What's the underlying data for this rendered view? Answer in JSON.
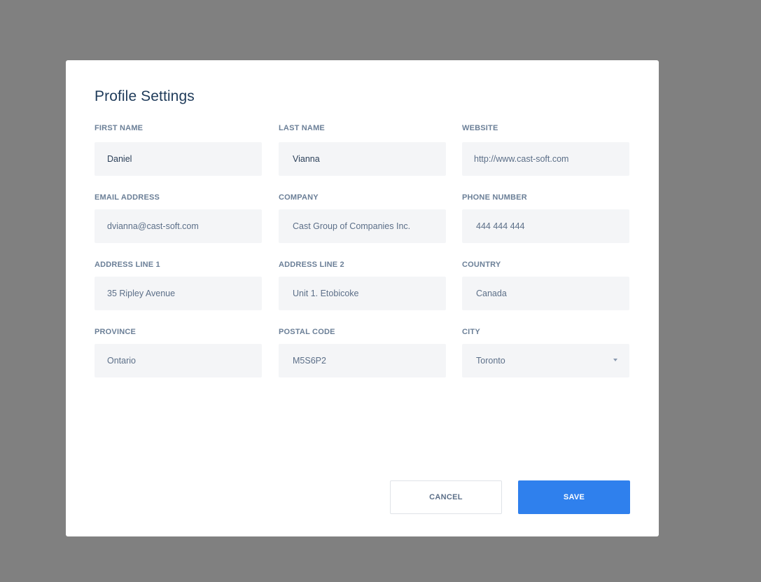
{
  "modal": {
    "title": "Profile Settings"
  },
  "fields": {
    "first_name": {
      "label": "FIRST NAME",
      "value": "Daniel"
    },
    "last_name": {
      "label": "LAST NAME",
      "value": "Vianna"
    },
    "website": {
      "label": "WEBSITE",
      "value": "http://www.cast-soft.com"
    },
    "email": {
      "label": "EMAIL ADDRESS",
      "value": "dvianna@cast-soft.com"
    },
    "company": {
      "label": "COMPANY",
      "value": "Cast Group of Companies Inc."
    },
    "phone": {
      "label": "PHONE NUMBER",
      "value": "444 444 444"
    },
    "address1": {
      "label": "ADDRESS LINE 1",
      "value": "35 Ripley Avenue"
    },
    "address2": {
      "label": "ADDRESS LINE 2",
      "value": "Unit 1. Etobicoke"
    },
    "country": {
      "label": "COUNTRY",
      "value": "Canada"
    },
    "province": {
      "label": "PROVINCE",
      "value": "Ontario"
    },
    "postal_code": {
      "label": "POSTAL CODE",
      "value": "M5S6P2"
    },
    "city": {
      "label": "CITY",
      "value": "Toronto"
    }
  },
  "icons": {
    "city_dropdown": "chevron-down-icon"
  },
  "buttons": {
    "cancel_label": "CANCEL",
    "save_label": "SAVE"
  },
  "colors": {
    "overlay": "#808080",
    "accent": "#2f80ed",
    "title": "#1f3b5a",
    "label": "#6b7f97",
    "input_bg": "#f4f5f7"
  }
}
